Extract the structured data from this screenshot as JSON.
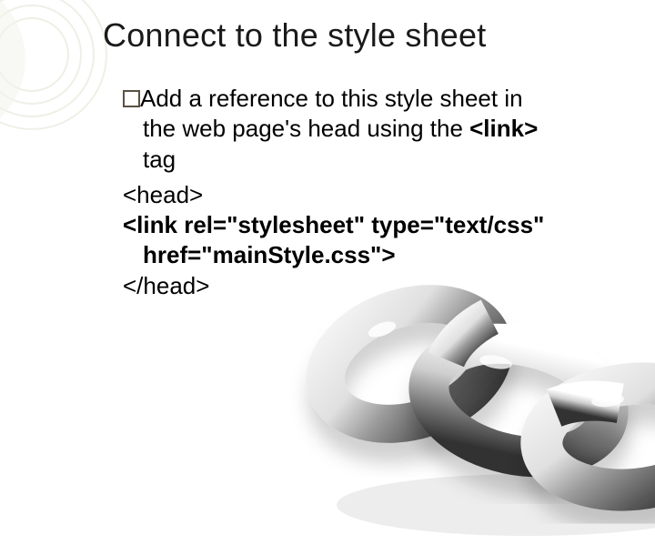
{
  "slide": {
    "title": "Connect to the style sheet",
    "bullet": {
      "lead": "Add",
      "rest1": " a reference to this style sheet in",
      "rest2": "the web page's head using the ",
      "tagword": "<link>",
      "rest3": "tag"
    },
    "code": {
      "line1": "<head>",
      "line2a": "<link rel=\"stylesheet\" type=\"text/css\"",
      "line2b": "href=\"mainStyle.css\">",
      "line3": "</head>"
    }
  }
}
